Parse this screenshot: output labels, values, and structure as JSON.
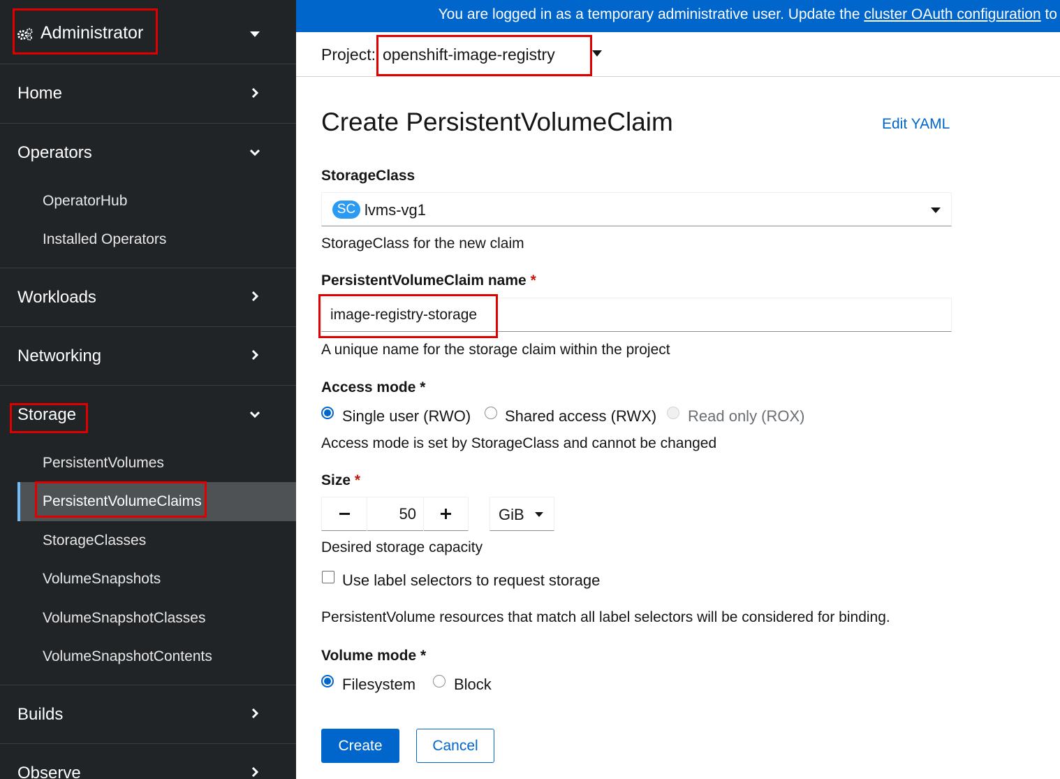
{
  "sidebar": {
    "perspective": {
      "label": "Administrator",
      "icon": "cog-icon"
    },
    "sections": [
      {
        "label": "Home",
        "expanded": false
      },
      {
        "label": "Operators",
        "expanded": true,
        "items": [
          "OperatorHub",
          "Installed Operators"
        ]
      },
      {
        "label": "Workloads",
        "expanded": false
      },
      {
        "label": "Networking",
        "expanded": false
      },
      {
        "label": "Storage",
        "expanded": true,
        "items": [
          "PersistentVolumes",
          "PersistentVolumeClaims",
          "StorageClasses",
          "VolumeSnapshots",
          "VolumeSnapshotClasses",
          "VolumeSnapshotContents"
        ],
        "active_item": "PersistentVolumeClaims"
      },
      {
        "label": "Builds",
        "expanded": false
      },
      {
        "label": "Observe",
        "expanded": false
      }
    ]
  },
  "banner": {
    "text_before": "You are logged in as a temporary administrative user. Update the ",
    "link_text": "cluster OAuth configuration",
    "text_after": " to"
  },
  "project": {
    "label": "Project:",
    "value": "openshift-image-registry"
  },
  "page": {
    "title": "Create PersistentVolumeClaim",
    "edit_yaml": "Edit YAML"
  },
  "form": {
    "storage_class": {
      "label": "StorageClass",
      "badge": "SC",
      "value": "lvms-vg1",
      "help": "StorageClass for the new claim"
    },
    "pvc_name": {
      "label": "PersistentVolumeClaim name",
      "required": "*",
      "value": "image-registry-storage",
      "help": "A unique name for the storage claim within the project"
    },
    "access_mode": {
      "label": "Access mode *",
      "options": [
        {
          "label": "Single user (RWO)",
          "checked": true,
          "disabled": false
        },
        {
          "label": "Shared access (RWX)",
          "checked": false,
          "disabled": false
        },
        {
          "label": "Read only (ROX)",
          "checked": false,
          "disabled": true
        }
      ],
      "help": "Access mode is set by StorageClass and cannot be changed"
    },
    "size": {
      "label": "Size",
      "required": "*",
      "value": "50",
      "unit": "GiB",
      "help": "Desired storage capacity"
    },
    "label_selector": {
      "label": "Use label selectors to request storage",
      "checked": false,
      "help": "PersistentVolume resources that match all label selectors will be considered for binding."
    },
    "volume_mode": {
      "label": "Volume mode *",
      "options": [
        {
          "label": "Filesystem",
          "checked": true
        },
        {
          "label": "Block",
          "checked": false
        }
      ]
    },
    "buttons": {
      "create": "Create",
      "cancel": "Cancel"
    }
  },
  "colors": {
    "accent": "#0066cc",
    "sidebar_bg": "#212427",
    "highlight": "#e00000",
    "required": "#c9190b"
  }
}
